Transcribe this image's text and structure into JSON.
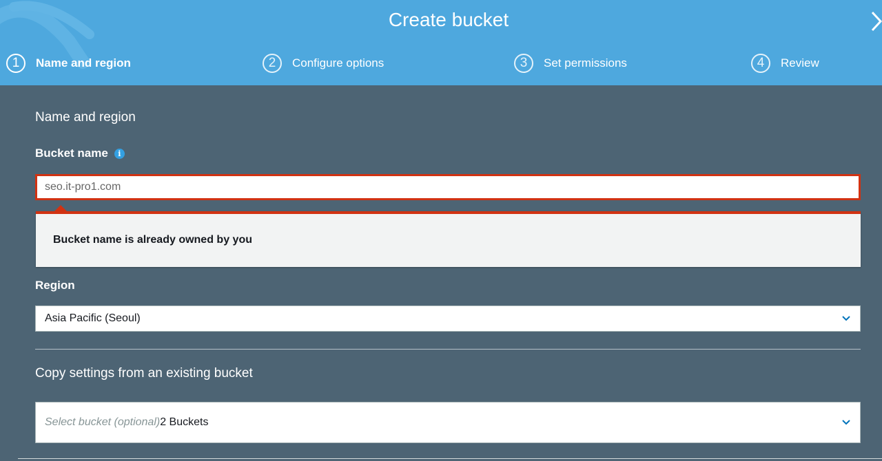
{
  "modal": {
    "title": "Create bucket"
  },
  "steps": [
    {
      "number": "1",
      "label": "Name and region",
      "active": true
    },
    {
      "number": "2",
      "label": "Configure options",
      "active": false
    },
    {
      "number": "3",
      "label": "Set permissions",
      "active": false
    },
    {
      "number": "4",
      "label": "Review",
      "active": false
    }
  ],
  "form": {
    "section_title": "Name and region",
    "bucket_name": {
      "label": "Bucket name",
      "value": "seo.it-pro1.com",
      "info_icon": "info-icon",
      "error": "Bucket name is already owned by you"
    },
    "region": {
      "label": "Region",
      "selected": "Asia Pacific (Seoul)"
    },
    "copy_settings": {
      "title": "Copy settings from an existing bucket",
      "placeholder": "Select bucket (optional)",
      "count": "2 Buckets"
    }
  },
  "colors": {
    "header_bg": "#4ea8de",
    "body_bg": "#4d6474",
    "error": "#d13212",
    "accent": "#0073bb"
  },
  "icons": [
    "close-icon",
    "info-icon",
    "chevron-down-icon"
  ]
}
